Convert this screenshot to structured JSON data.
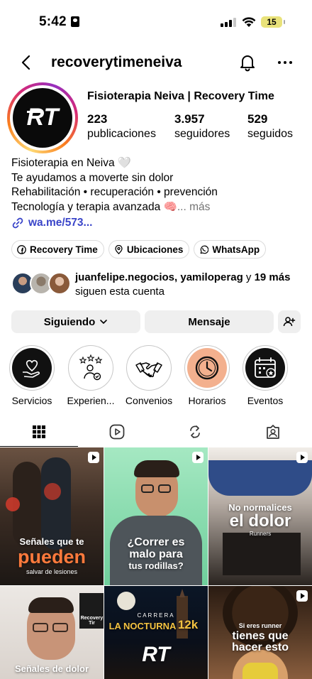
{
  "status_bar": {
    "time": "5:42",
    "battery": "15"
  },
  "header": {
    "username": "recoverytimeneiva"
  },
  "profile": {
    "logo_text": "RT",
    "display_name": "Fisioterapia Neiva | Recovery Time",
    "stats": [
      {
        "value": "223",
        "label": "publicaciones"
      },
      {
        "value": "3.957",
        "label": "seguidores"
      },
      {
        "value": "529",
        "label": "seguidos"
      }
    ],
    "bio": [
      "Fisioterapia en Neiva 🤍",
      "Te ayudamos a moverte sin dolor",
      "Rehabilitación • recuperación • prevención",
      "Tecnología y terapia avanzada 🧠"
    ],
    "bio_more": "... más",
    "link": "wa.me/573..."
  },
  "chips": [
    {
      "icon": "facebook-icon",
      "label": "Recovery Time"
    },
    {
      "icon": "location-pin-icon",
      "label": "Ubicaciones"
    },
    {
      "icon": "whatsapp-icon",
      "label": "WhatsApp"
    }
  ],
  "followed_by": {
    "names": "juanfelipe.negocios, yamiloperag",
    "connector": " y ",
    "others": "19 más",
    "suffix": " siguen esta cuenta"
  },
  "actions": {
    "following": "Siguiendo",
    "message": "Mensaje"
  },
  "highlights": [
    {
      "label": "Servicios",
      "icon": "hands-heart-icon"
    },
    {
      "label": "Experien...",
      "icon": "rating-stars-icon"
    },
    {
      "label": "Convenios",
      "icon": "handshake-icon"
    },
    {
      "label": "Horarios",
      "icon": "clock-icon"
    },
    {
      "label": "Eventos",
      "icon": "calendar-icon"
    }
  ],
  "tabs": [
    {
      "icon": "grid-icon"
    },
    {
      "icon": "reels-icon"
    },
    {
      "icon": "reposts-icon"
    },
    {
      "icon": "tagged-icon"
    }
  ],
  "posts": [
    {
      "lines": [
        "Señales que te",
        "pueden",
        "salvar de lesiones"
      ]
    },
    {
      "lines": [
        "¿Correr es",
        "malo para",
        "tus rodillas?"
      ]
    },
    {
      "lines": [
        "No normalices",
        "el dolor",
        "Runners"
      ]
    },
    {
      "lines": [
        "Señales de dolor"
      ],
      "badge": "Recovery Tir"
    },
    {
      "lines": [
        "CARRERA",
        "LA NOCTURNA",
        "12k"
      ],
      "logo": "RT"
    },
    {
      "lines": [
        "Si eres runner",
        "tienes que",
        "hacer esto"
      ]
    }
  ],
  "colors": {
    "link": "#3a45c9",
    "button_bg": "#efefef",
    "accent_orange": "#f3b08e"
  }
}
